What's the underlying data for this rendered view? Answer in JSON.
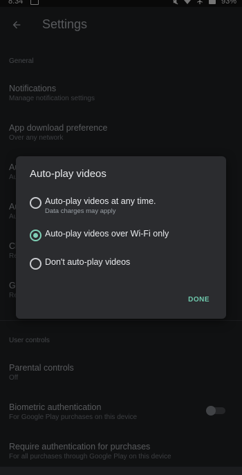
{
  "status_bar": {
    "time": "8:34",
    "battery": "93%",
    "icons": [
      "image-icon",
      "mute-icon",
      "wifi-icon",
      "airplane-icon",
      "battery-icon"
    ]
  },
  "toolbar": {
    "back_icon": "arrow-back-icon",
    "title": "Settings"
  },
  "general_section": {
    "header": "General",
    "items": [
      {
        "title": "Notifications",
        "subtitle": "Manage notification settings"
      },
      {
        "title": "App download preference",
        "subtitle": "Over any network"
      },
      {
        "title": "Au",
        "subtitle": "Au"
      },
      {
        "title": "Au",
        "subtitle": "Au"
      },
      {
        "title": "Cl",
        "subtitle": "Re"
      },
      {
        "title": "Go",
        "subtitle": "Re"
      }
    ]
  },
  "user_controls_section": {
    "header": "User controls",
    "items": [
      {
        "title": "Parental controls",
        "subtitle": "Off"
      },
      {
        "title": "Biometric authentication",
        "subtitle": "For Google Play purchases on this device",
        "toggle": false
      },
      {
        "title": "Require authentication for purchases",
        "subtitle": "For all purchases through Google Play on this device"
      }
    ]
  },
  "dialog": {
    "title": "Auto-play videos",
    "options": [
      {
        "label": "Auto-play videos at any time.",
        "sublabel": "Data charges may apply",
        "selected": false
      },
      {
        "label": "Auto-play videos over Wi-Fi only",
        "selected": true
      },
      {
        "label": "Don't auto-play videos",
        "selected": false
      }
    ],
    "done_label": "DONE"
  },
  "colors": {
    "background": "#1b1c1e",
    "dialog": "#2b2c2f",
    "accent": "#7fcfb5"
  }
}
